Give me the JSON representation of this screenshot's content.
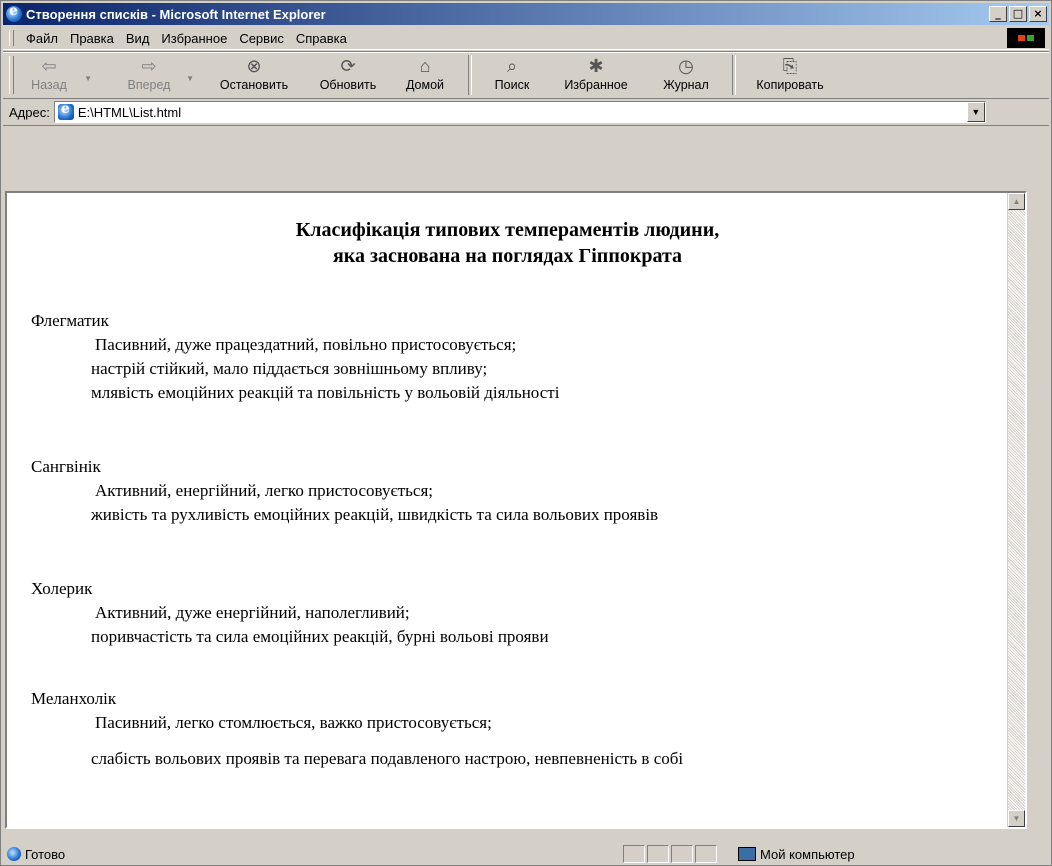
{
  "window": {
    "title": "Створення списків - Microsoft Internet Explorer"
  },
  "menu": [
    "Файл",
    "Правка",
    "Вид",
    "Избранное",
    "Сервис",
    "Справка"
  ],
  "toolbar": {
    "back": "Назад",
    "forward": "Вперед",
    "stop": "Остановить",
    "refresh": "Обновить",
    "home": "Домой",
    "search": "Поиск",
    "favorites": "Избранное",
    "history": "Журнал",
    "copy": "Копировать"
  },
  "address": {
    "label": "Адрес:",
    "value": "E:\\HTML\\List.html"
  },
  "document": {
    "title_line1": "Класифікація типових темпераментів людини,",
    "title_line2": "яка заснована на поглядах Гіппократа",
    "items": [
      {
        "term": "Флегматик",
        "defs": [
          "Пасивний, дуже працездатний, повільно пристосовується;",
          "настрій стійкий, мало піддається зовнішньому впливу;",
          "млявість емоційних реакцій та повільність у вольовій діяльності"
        ]
      },
      {
        "term": "Сангвінік",
        "defs": [
          "Активний, енергійний, легко пристосовується;",
          "живість та рухливість емоційних реакцій, швидкість та сила вольових проявів"
        ]
      },
      {
        "term": "Холерик",
        "defs": [
          "Активний, дуже енергійний, наполегливий;",
          "поривчастість та сила емоційних реакцій, бурні вольові прояви"
        ]
      },
      {
        "term": "Меланхолік",
        "defs": [
          "Пасивний, легко стомлюється, важко пристосовується;",
          "слабість вольових проявів та перевага подавленого настрою, невпевненість в собі"
        ]
      }
    ]
  },
  "status": {
    "text": "Готово",
    "zone": "Мой компьютер"
  }
}
